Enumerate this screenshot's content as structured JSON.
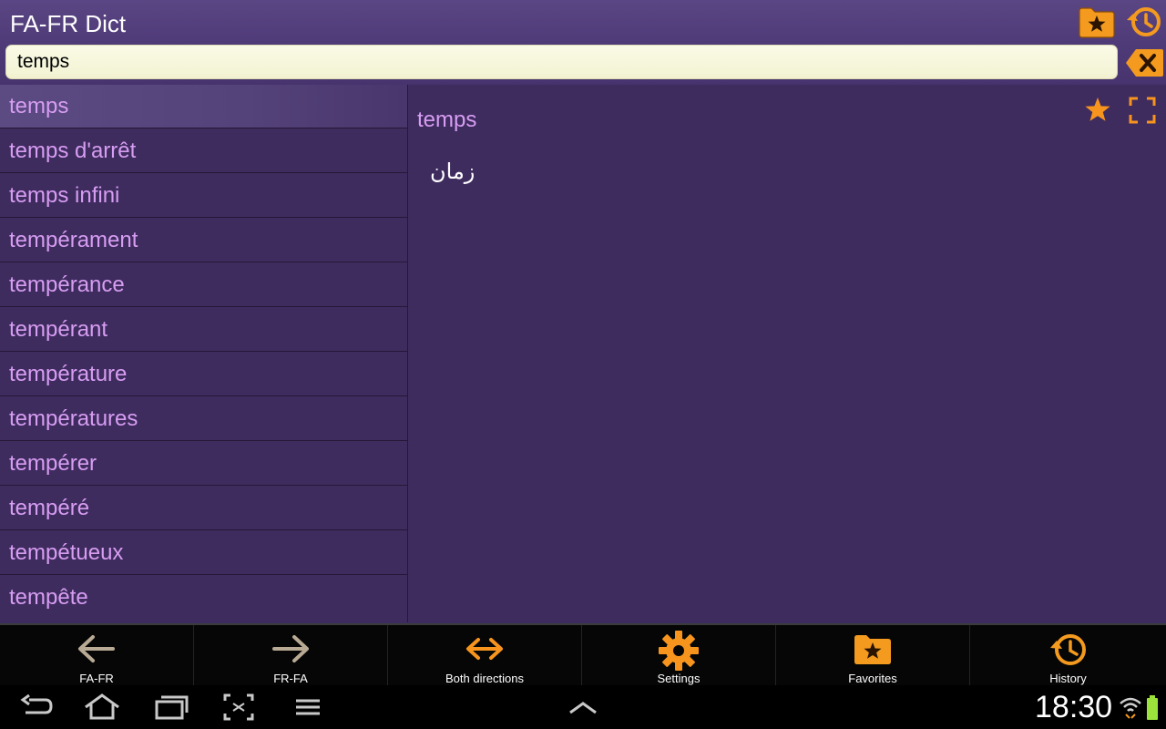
{
  "app": {
    "title": "FA-FR Dict"
  },
  "header": {
    "favorites_folder_icon": "folder-star-icon",
    "history_icon": "history-clock-icon"
  },
  "search": {
    "value": "temps",
    "placeholder": "",
    "clear_icon": "backspace-clear-icon"
  },
  "word_list": {
    "items": [
      {
        "label": "temps",
        "selected": true
      },
      {
        "label": "temps d'arrêt"
      },
      {
        "label": "temps infini"
      },
      {
        "label": "tempérament"
      },
      {
        "label": "tempérance"
      },
      {
        "label": "tempérant"
      },
      {
        "label": "température"
      },
      {
        "label": "températures"
      },
      {
        "label": "tempérer"
      },
      {
        "label": "tempéré"
      },
      {
        "label": "tempétueux"
      },
      {
        "label": "tempête"
      }
    ]
  },
  "detail": {
    "word": "temps",
    "translation": "زمان",
    "favorite_icon": "star-icon",
    "fullscreen_icon": "expand-icon"
  },
  "toolbar": {
    "buttons": [
      {
        "label": "FA-FR",
        "icon": "arrow-left-icon"
      },
      {
        "label": "FR-FA",
        "icon": "arrow-right-icon"
      },
      {
        "label": "Both directions",
        "icon": "arrow-both-icon"
      },
      {
        "label": "Settings",
        "icon": "gear-icon"
      },
      {
        "label": "Favorites",
        "icon": "folder-star-icon"
      },
      {
        "label": "History",
        "icon": "history-clock-icon"
      }
    ]
  },
  "system_bar": {
    "time": "18:30",
    "icons": [
      "back-icon",
      "home-icon",
      "recent-apps-icon",
      "screenshot-icon",
      "menu-icon",
      "chevron-up-icon",
      "wifi-icon",
      "battery-icon"
    ]
  },
  "colors": {
    "background": "#3f2c5f",
    "header": "#4e3a77",
    "word_text": "#d79df2",
    "accent_orange": "#f7941d",
    "search_bg": "#f8f8de"
  }
}
